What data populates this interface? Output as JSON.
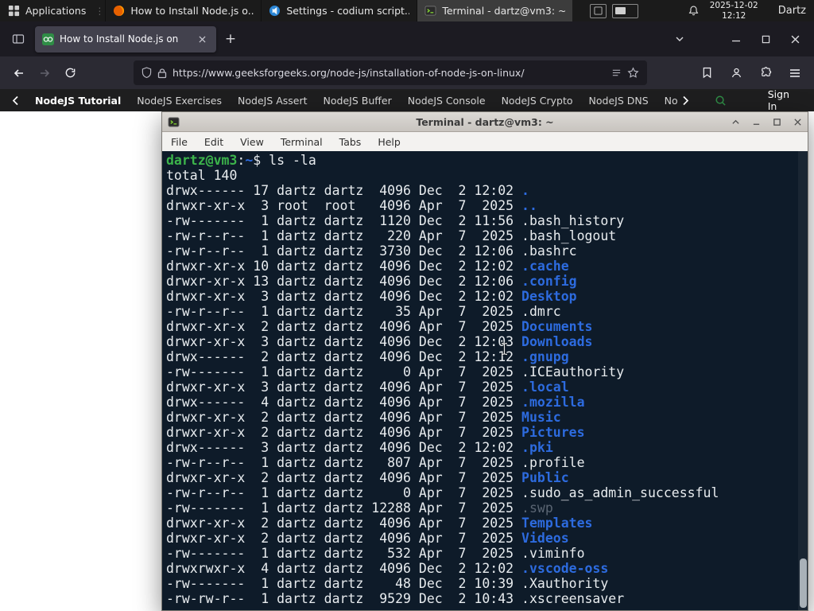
{
  "panel": {
    "applications_label": "Applications",
    "window_buttons": [
      {
        "title": "How to Install Node.js o..."
      },
      {
        "title": "Settings - codium script..."
      },
      {
        "title": "Terminal - dartz@vm3: ~"
      }
    ],
    "clock": {
      "date": "2025-12-02",
      "time": "12:12"
    },
    "user": "Dartz"
  },
  "browser": {
    "tab_title": "How to Install Node.js on",
    "new_tab_label": "+",
    "url": "https://www.geeksforgeeks.org/node-js/installation-of-node-js-on-linux/"
  },
  "site_nav": {
    "links": [
      "NodeJS Tutorial",
      "NodeJS Exercises",
      "NodeJS Assert",
      "NodeJS Buffer",
      "NodeJS Console",
      "NodeJS Crypto",
      "NodeJS DNS",
      "Node"
    ],
    "sign_in_label": "Sign In"
  },
  "terminal": {
    "window_title": "Terminal - dartz@vm3: ~",
    "menu": [
      "File",
      "Edit",
      "View",
      "Terminal",
      "Tabs",
      "Help"
    ],
    "prompt": {
      "user_host": "dartz@vm3",
      "colon": ":",
      "path": "~",
      "dollar": "$",
      "command": " ls -la"
    },
    "rows": [
      {
        "text": "total 140"
      },
      {
        "meta": "drwx------ 17 dartz dartz  4096 Dec  2 12:02 ",
        "name": ".",
        "type": "dir"
      },
      {
        "meta": "drwxr-xr-x  3 root  root   4096 Apr  7  2025 ",
        "name": "..",
        "type": "dir"
      },
      {
        "meta": "-rw-------  1 dartz dartz  1120 Dec  2 11:56 ",
        "name": ".bash_history",
        "type": "file"
      },
      {
        "meta": "-rw-r--r--  1 dartz dartz   220 Apr  7  2025 ",
        "name": ".bash_logout",
        "type": "file"
      },
      {
        "meta": "-rw-r--r--  1 dartz dartz  3730 Dec  2 12:06 ",
        "name": ".bashrc",
        "type": "file"
      },
      {
        "meta": "drwxr-xr-x 10 dartz dartz  4096 Dec  2 12:02 ",
        "name": ".cache",
        "type": "dir"
      },
      {
        "meta": "drwxr-xr-x 13 dartz dartz  4096 Dec  2 12:06 ",
        "name": ".config",
        "type": "dir"
      },
      {
        "meta": "drwxr-xr-x  3 dartz dartz  4096 Dec  2 12:02 ",
        "name": "Desktop",
        "type": "dir"
      },
      {
        "meta": "-rw-r--r--  1 dartz dartz    35 Apr  7  2025 ",
        "name": ".dmrc",
        "type": "file"
      },
      {
        "meta": "drwxr-xr-x  2 dartz dartz  4096 Apr  7  2025 ",
        "name": "Documents",
        "type": "dir"
      },
      {
        "meta": "drwxr-xr-x  3 dartz dartz  4096 Dec  2 12:03 ",
        "name": "Downloads",
        "type": "dir"
      },
      {
        "meta": "drwx------  2 dartz dartz  4096 Dec  2 12:12 ",
        "name": ".gnupg",
        "type": "dir"
      },
      {
        "meta": "-rw-------  1 dartz dartz     0 Apr  7  2025 ",
        "name": ".ICEauthority",
        "type": "file"
      },
      {
        "meta": "drwxr-xr-x  3 dartz dartz  4096 Apr  7  2025 ",
        "name": ".local",
        "type": "dir"
      },
      {
        "meta": "drwx------  4 dartz dartz  4096 Apr  7  2025 ",
        "name": ".mozilla",
        "type": "dir"
      },
      {
        "meta": "drwxr-xr-x  2 dartz dartz  4096 Apr  7  2025 ",
        "name": "Music",
        "type": "dir"
      },
      {
        "meta": "drwxr-xr-x  2 dartz dartz  4096 Apr  7  2025 ",
        "name": "Pictures",
        "type": "dir"
      },
      {
        "meta": "drwx------  3 dartz dartz  4096 Dec  2 12:02 ",
        "name": ".pki",
        "type": "dir"
      },
      {
        "meta": "-rw-r--r--  1 dartz dartz   807 Apr  7  2025 ",
        "name": ".profile",
        "type": "file"
      },
      {
        "meta": "drwxr-xr-x  2 dartz dartz  4096 Apr  7  2025 ",
        "name": "Public",
        "type": "dir"
      },
      {
        "meta": "-rw-r--r--  1 dartz dartz     0 Apr  7  2025 ",
        "name": ".sudo_as_admin_successful",
        "type": "file"
      },
      {
        "meta": "-rw-------  1 dartz dartz 12288 Apr  7  2025 ",
        "name": ".swp",
        "type": "dim"
      },
      {
        "meta": "drwxr-xr-x  2 dartz dartz  4096 Apr  7  2025 ",
        "name": "Templates",
        "type": "dir"
      },
      {
        "meta": "drwxr-xr-x  2 dartz dartz  4096 Apr  7  2025 ",
        "name": "Videos",
        "type": "dir"
      },
      {
        "meta": "-rw-------  1 dartz dartz   532 Apr  7  2025 ",
        "name": ".viminfo",
        "type": "file"
      },
      {
        "meta": "drwxrwxr-x  4 dartz dartz  4096 Dec  2 12:02 ",
        "name": ".vscode-oss",
        "type": "dir"
      },
      {
        "meta": "-rw-------  1 dartz dartz    48 Dec  2 10:39 ",
        "name": ".Xauthority",
        "type": "file"
      },
      {
        "meta": "-rw-rw-r--  1 dartz dartz  9529 Dec  2 10:43 ",
        "name": ".xscreensaver",
        "type": "file"
      }
    ]
  },
  "colors": {
    "accent_green": "#3cb44b",
    "dir_blue": "#2d6bdf",
    "gfg_green": "#2f8d46",
    "firefox_orange": "#ff9500",
    "terminal_bg": "#0e1b29"
  }
}
